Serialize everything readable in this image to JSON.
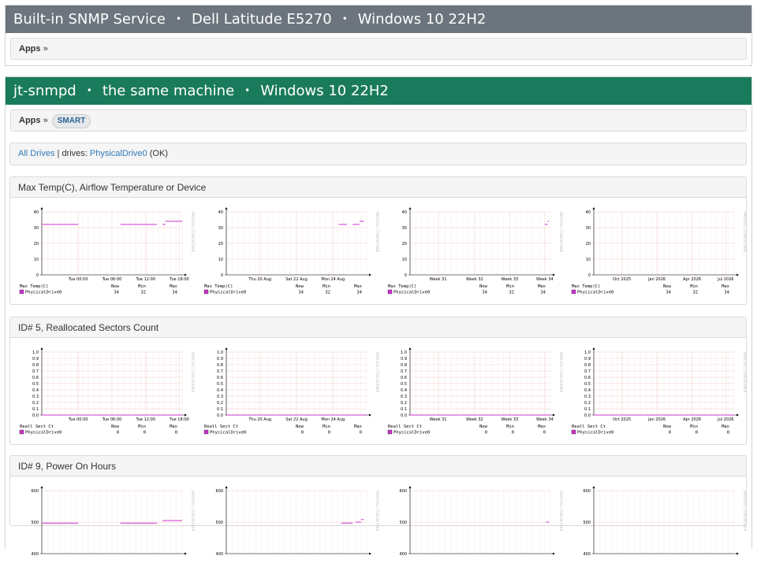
{
  "sections": [
    {
      "title": [
        "Built-in SNMP Service",
        "Dell Latitude E5270",
        "Windows 10 22H2"
      ],
      "breadcrumb": "Apps",
      "sep": "»"
    },
    {
      "title": [
        "jt-snmpd",
        "the same machine",
        "Windows 10 22H2"
      ],
      "breadcrumb": "Apps",
      "sep": "»",
      "pill": "SMART"
    }
  ],
  "separator_dot": "•",
  "drives": {
    "all_link": "All Drives",
    "sep": "|",
    "prefix": "drives:",
    "drive_link": "PhysicalDrive0",
    "status": "(OK)"
  },
  "side_label": "RRDTOOL / TOBI OETIKER",
  "periods": [
    {
      "xticks": [
        "Tue 00:00",
        "Tue 06:00",
        "Tue 12:00",
        "Tue 18:00"
      ]
    },
    {
      "xticks": [
        "Thu 20 Aug",
        "Sat 22 Aug",
        "Mon 24 Aug"
      ]
    },
    {
      "xticks": [
        "Week 31",
        "Week 32",
        "Week 33",
        "Week 34"
      ]
    },
    {
      "xticks": [
        "Oct 2025",
        "Jan 2026",
        "Apr 2026",
        "Jul 2026"
      ]
    }
  ],
  "legend_header": {
    "now": "Now",
    "min": "Min",
    "max": "Max"
  },
  "panels": [
    {
      "title": "Max Temp(C), Airflow Temperature or Device",
      "metric": "Max Temp(C)",
      "series": "PhysicalDrive0",
      "yticks": [
        "40",
        "30",
        "20",
        "10",
        "0"
      ],
      "stats": [
        {
          "now": "34",
          "min": "32",
          "max": "34"
        },
        {
          "now": "34",
          "min": "32",
          "max": "34"
        },
        {
          "now": "34",
          "min": "32",
          "max": "34"
        },
        {
          "now": "34",
          "min": "32",
          "max": "34"
        }
      ]
    },
    {
      "title": "ID# 5, Reallocated Sectors Count",
      "metric": "Reall Sect Ct",
      "series": "PhysicalDrive0",
      "yticks": [
        "1.0",
        "0.9",
        "0.8",
        "0.7",
        "0.6",
        "0.5",
        "0.4",
        "0.3",
        "0.2",
        "0.1",
        "0.0"
      ],
      "stats": [
        {
          "now": "0",
          "min": "0",
          "max": "0"
        },
        {
          "now": "0",
          "min": "0",
          "max": "0"
        },
        {
          "now": "0",
          "min": "0",
          "max": "0"
        },
        {
          "now": "0",
          "min": "0",
          "max": "0"
        }
      ]
    },
    {
      "title": "ID# 9, Power On Hours",
      "metric": "",
      "series": "",
      "yticks": [
        "600",
        "500",
        "400"
      ],
      "stats": []
    }
  ],
  "colors": {
    "series": "#cc33cc",
    "grid": "#f2c9c9",
    "gray_header": "#6c757d",
    "green_header": "#1a7b5c"
  }
}
